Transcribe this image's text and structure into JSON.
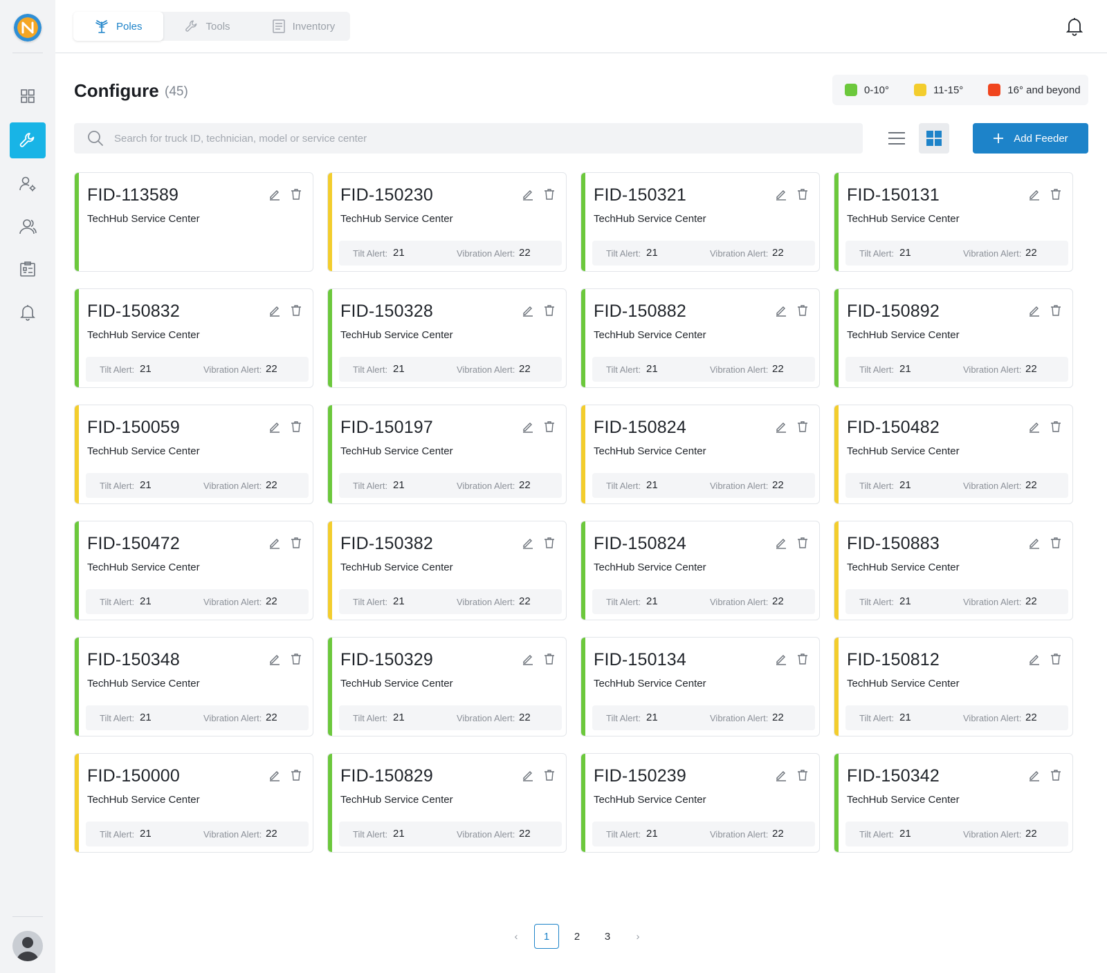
{
  "app": {
    "logo_icon": "brand-logo"
  },
  "nav": {
    "items": [
      {
        "name": "dashboard",
        "icon": "grid-icon",
        "active": false
      },
      {
        "name": "configure",
        "icon": "wrench-icon",
        "active": true
      },
      {
        "name": "user-settings",
        "icon": "user-gear-icon",
        "active": false
      },
      {
        "name": "users",
        "icon": "users-icon",
        "active": false
      },
      {
        "name": "reports",
        "icon": "clipboard-icon",
        "active": false
      },
      {
        "name": "alerts",
        "icon": "bell-icon",
        "active": false
      }
    ]
  },
  "tabs": [
    {
      "label": "Poles",
      "icon": "antenna-icon",
      "active": true
    },
    {
      "label": "Tools",
      "icon": "wrench-icon",
      "active": false
    },
    {
      "label": "Inventory",
      "icon": "list-icon",
      "active": false
    }
  ],
  "header": {
    "title": "Configure",
    "count": "(45)"
  },
  "legend": [
    {
      "label": "0-10°",
      "color": "#6cc83c"
    },
    {
      "label": "11-15°",
      "color": "#f3cd2d"
    },
    {
      "label": "16° and beyond",
      "color": "#f0451e"
    }
  ],
  "search": {
    "placeholder": "Search for truck ID, technician, model or service center",
    "value": ""
  },
  "toolbar": {
    "add_label": "Add Feeder"
  },
  "labels": {
    "tilt": "Tilt Alert:",
    "vibration": "Vibration Alert:"
  },
  "cards": [
    {
      "id": "FID-113589",
      "center": "TechHub Service Center",
      "status": "green",
      "tilt": null,
      "vibration": null
    },
    {
      "id": "FID-150230",
      "center": "TechHub Service Center",
      "status": "yellow",
      "tilt": "21",
      "vibration": "22"
    },
    {
      "id": "FID-150321",
      "center": "TechHub Service Center",
      "status": "green",
      "tilt": "21",
      "vibration": "22"
    },
    {
      "id": "FID-150131",
      "center": "TechHub Service Center",
      "status": "green",
      "tilt": "21",
      "vibration": "22"
    },
    {
      "id": "FID-150832",
      "center": "TechHub Service Center",
      "status": "green",
      "tilt": "21",
      "vibration": "22"
    },
    {
      "id": "FID-150328",
      "center": "TechHub Service Center",
      "status": "green",
      "tilt": "21",
      "vibration": "22"
    },
    {
      "id": "FID-150882",
      "center": "TechHub Service Center",
      "status": "green",
      "tilt": "21",
      "vibration": "22"
    },
    {
      "id": "FID-150892",
      "center": "TechHub Service Center",
      "status": "green",
      "tilt": "21",
      "vibration": "22"
    },
    {
      "id": "FID-150059",
      "center": "TechHub Service Center",
      "status": "yellow",
      "tilt": "21",
      "vibration": "22"
    },
    {
      "id": "FID-150197",
      "center": "TechHub Service Center",
      "status": "green",
      "tilt": "21",
      "vibration": "22"
    },
    {
      "id": "FID-150824",
      "center": "TechHub Service Center",
      "status": "yellow",
      "tilt": "21",
      "vibration": "22"
    },
    {
      "id": "FID-150482",
      "center": "TechHub Service Center",
      "status": "yellow",
      "tilt": "21",
      "vibration": "22"
    },
    {
      "id": "FID-150472",
      "center": "TechHub Service Center",
      "status": "green",
      "tilt": "21",
      "vibration": "22"
    },
    {
      "id": "FID-150382",
      "center": "TechHub Service Center",
      "status": "yellow",
      "tilt": "21",
      "vibration": "22"
    },
    {
      "id": "FID-150824",
      "center": "TechHub Service Center",
      "status": "green",
      "tilt": "21",
      "vibration": "22"
    },
    {
      "id": "FID-150883",
      "center": "TechHub Service Center",
      "status": "yellow",
      "tilt": "21",
      "vibration": "22"
    },
    {
      "id": "FID-150348",
      "center": "TechHub Service Center",
      "status": "green",
      "tilt": "21",
      "vibration": "22"
    },
    {
      "id": "FID-150329",
      "center": "TechHub Service Center",
      "status": "green",
      "tilt": "21",
      "vibration": "22"
    },
    {
      "id": "FID-150134",
      "center": "TechHub Service Center",
      "status": "green",
      "tilt": "21",
      "vibration": "22"
    },
    {
      "id": "FID-150812",
      "center": "TechHub Service Center",
      "status": "yellow",
      "tilt": "21",
      "vibration": "22"
    },
    {
      "id": "FID-150000",
      "center": "TechHub Service Center",
      "status": "yellow",
      "tilt": "21",
      "vibration": "22"
    },
    {
      "id": "FID-150829",
      "center": "TechHub Service Center",
      "status": "green",
      "tilt": "21",
      "vibration": "22"
    },
    {
      "id": "FID-150239",
      "center": "TechHub Service Center",
      "status": "green",
      "tilt": "21",
      "vibration": "22"
    },
    {
      "id": "FID-150342",
      "center": "TechHub Service Center",
      "status": "green",
      "tilt": "21",
      "vibration": "22"
    }
  ],
  "status_colors": {
    "green": "#6cc83c",
    "yellow": "#f3cd2d",
    "red": "#f0451e"
  },
  "pagination": {
    "pages": [
      "1",
      "2",
      "3"
    ],
    "current": "1",
    "prev": "‹",
    "next": "›"
  }
}
